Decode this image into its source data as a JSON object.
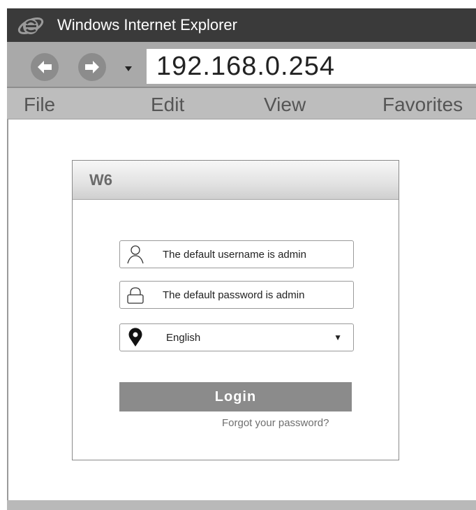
{
  "window": {
    "title": "Windows Internet Explorer",
    "icon": "internet-explorer-logo-icon"
  },
  "address_bar": {
    "url": "192.168.0.254",
    "back_icon": "back-arrow-icon",
    "forward_icon": "forward-arrow-icon",
    "history_icon": "history-dropdown-icon"
  },
  "menu": {
    "items": [
      "File",
      "Edit",
      "View",
      "Favorites"
    ]
  },
  "login_card": {
    "title": "W6",
    "username_field": {
      "text": "The default username is admin",
      "icon": "user-icon"
    },
    "password_field": {
      "text": "The default password is admin",
      "icon": "lock-icon"
    },
    "language_select": {
      "value": "English",
      "icon": "location-pin-icon",
      "arrow": "▼"
    },
    "login_button": "Login",
    "forgot_link": "Forgot your password?"
  },
  "colors": {
    "title_bar": "#3a3a3a",
    "address_bar": "#a9a9a9",
    "menu_bar": "#bdbdbd",
    "login_button": "#8b8b8b"
  }
}
